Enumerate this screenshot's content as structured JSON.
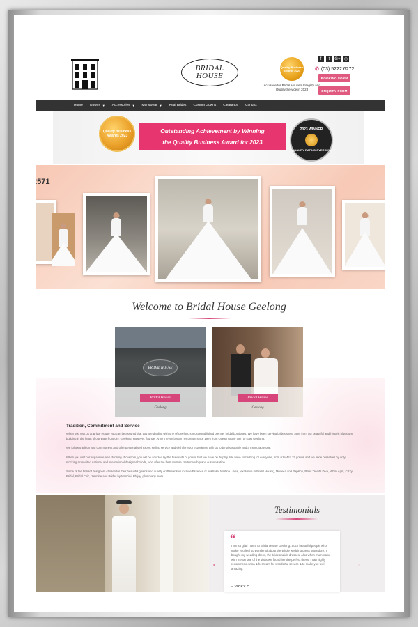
{
  "header": {
    "logo_text_line1": "BRIDAL",
    "logo_text_line2": "HOUSE",
    "award_badge": "Quality Business Awards 2023",
    "award_caption": "Accolade for Bridal House's Integrity and Quality Service in 2023",
    "social": [
      "f",
      "t",
      "G+",
      "◎"
    ],
    "phone": "(03) 5222 6272",
    "booking_button": "BOOKING FORM",
    "enquiry_button": "ENQUIRY FORM"
  },
  "nav": {
    "items": [
      {
        "label": "Home",
        "dropdown": false
      },
      {
        "label": "Gowns",
        "dropdown": true
      },
      {
        "label": "Accessories",
        "dropdown": true
      },
      {
        "label": "Menswear",
        "dropdown": true
      },
      {
        "label": "Real Brides",
        "dropdown": false
      },
      {
        "label": "Custom Gowns",
        "dropdown": false
      },
      {
        "label": "Clearance",
        "dropdown": false
      },
      {
        "label": "Contact",
        "dropdown": false
      }
    ]
  },
  "banner": {
    "medal": "Quality Business Awards 2023",
    "line1": "Outstanding Achievement by Winning",
    "line2": "the Quality Business Award for 2023",
    "seal_top": "2023 WINNER",
    "seal_bottom": "QUALITY RATING OVER 90%"
  },
  "gallery": {
    "number": "2571"
  },
  "welcome": {
    "title": "Welcome to Bridal House Geelong",
    "card1_tag": "Bridal House",
    "card1_sub": "Geelong",
    "card2_tag": "Bridal House",
    "card2_sub": "Geelong",
    "storefront_sign": "BRIDAL HOUSE"
  },
  "content": {
    "section_title": "Tradition, Commitment and Service",
    "p1": "When you visit us at Bridal House you can be assured that you are dealing with one of Geelong's most established premier bridal boutiques. We have been serving brides since 1994 from our beautiful and historic bluestone building in the heart of our waterfront city, Geelong. However, founder Anne Trevan began her dream since 1976 from Ocean Grove then to East Geelong.",
    "p2": "We follow tradition and commitment and offer personalised expert styling service and wish for your experience with us to be pleasurable and a memorable one.",
    "p3": "When you visit our expansive and stunning showroom, you will be amazed by the hundreds of gowns that we have on display. We have something for everyone, from size 4 to 32 gowns and we pride ourselves by only stocking accredited national and international designer brands, who offer the best couture craftsmanship and customisation.",
    "p4": "Some of the brilliant designers chosen for their beautiful gowns and quality craftsmanship include Essence of Australia, Martina Liana, (exclusive to Bridal House), Modeca and Papillon, Peter Trends Diva, White April, Cizzy Bridal, Bridal Chic, Jasmine and Brides by Mancini, Bb.joy, plus many more..."
  },
  "testimonials": {
    "title": "Testimonials",
    "quote": "I am so glad I went to Bridal House Geelong. Such beautiful people who make you feel so wonderful about the whole wedding dress procedure. I bought my wedding dress, the bridesmaids dresses. Also when mum came with me on one of the visits we found her the perfect dress. I can highly recommend Anna & her team for wonderful service & to make you feel amazing.",
    "author": "– VICKY C",
    "prev": "‹",
    "next": "›"
  }
}
